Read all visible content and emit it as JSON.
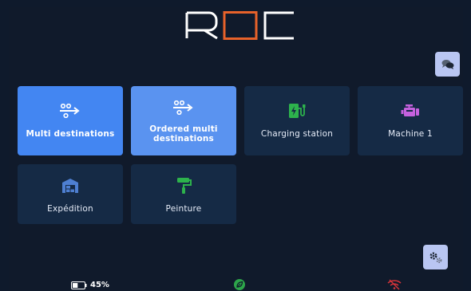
{
  "app": {
    "logo_text": "ROC",
    "colors": {
      "background": "#101a2b",
      "tile_dark": "#152a45",
      "tile_active": "#4386f2",
      "accent_orange": "#e8622a",
      "button_light": "#b9c6f2",
      "green": "#2da54a",
      "red": "#d9343a"
    }
  },
  "header": {
    "chat_icon": "chat-bubbles-icon"
  },
  "tiles": [
    {
      "label": "Multi destinations",
      "icon": "route-arrow-icon",
      "state": "selected"
    },
    {
      "label": "Ordered multi destinations",
      "icon": "route-arrow-icon",
      "state": "selected"
    },
    {
      "label": "Charging station",
      "icon": "charging-station-icon",
      "state": "default"
    },
    {
      "label": "Machine 1",
      "icon": "engine-icon",
      "state": "default"
    },
    {
      "label": "Expédition",
      "icon": "warehouse-icon",
      "state": "default"
    },
    {
      "label": "Peinture",
      "icon": "paint-roller-icon",
      "state": "default"
    }
  ],
  "footer": {
    "battery_text": "45%",
    "battery_level": 0.45,
    "settings_icon": "gears-icon",
    "eco_icon": "leaf-icon",
    "wifi_icon": "wifi-off-icon"
  }
}
